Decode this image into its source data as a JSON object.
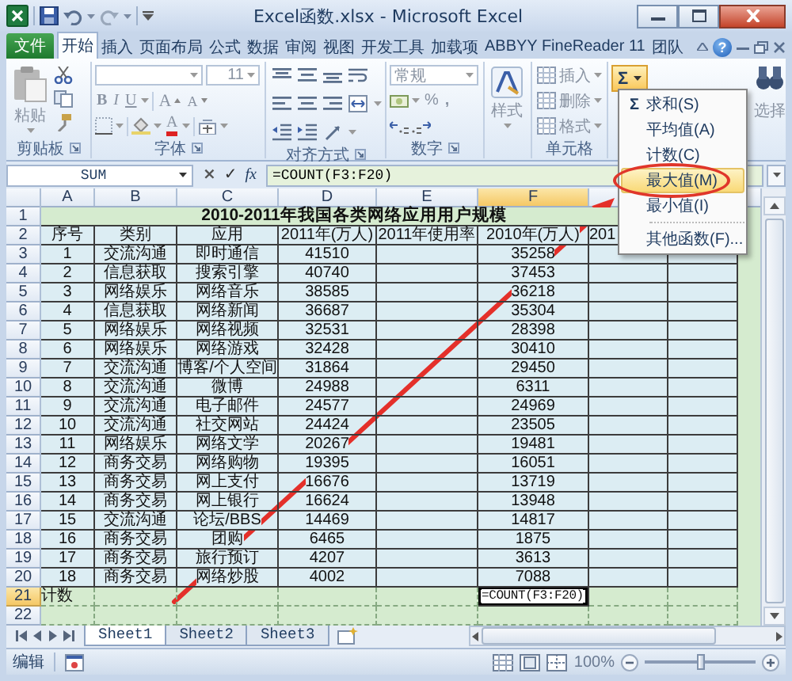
{
  "window": {
    "title": "Excel函数.xlsx - Microsoft Excel"
  },
  "ribbon_tabs": [
    {
      "label": "文件",
      "kind": "file",
      "selected": false
    },
    {
      "label": "开始",
      "kind": "tab",
      "selected": true
    },
    {
      "label": "插入",
      "kind": "tab",
      "selected": false
    },
    {
      "label": "页面布局",
      "kind": "tab",
      "selected": false
    },
    {
      "label": "公式",
      "kind": "tab",
      "selected": false
    },
    {
      "label": "数据",
      "kind": "tab",
      "selected": false
    },
    {
      "label": "审阅",
      "kind": "tab",
      "selected": false
    },
    {
      "label": "视图",
      "kind": "tab",
      "selected": false
    },
    {
      "label": "开发工具",
      "kind": "tab",
      "selected": false
    },
    {
      "label": "加载项",
      "kind": "tab",
      "selected": false
    },
    {
      "label": "ABBYY FineReader 11",
      "kind": "tab",
      "selected": false
    },
    {
      "label": "团队",
      "kind": "tab",
      "selected": false
    }
  ],
  "help": "?",
  "ribbon": {
    "disabled": true,
    "clipboard": {
      "label": "剪贴板",
      "paste": "粘贴"
    },
    "font": {
      "label": "字体",
      "size": "11",
      "bold": "B",
      "italic": "I",
      "underline": "U",
      "grow": "A",
      "shrink": "A",
      "font_color": "A"
    },
    "alignment": {
      "label": "对齐方式"
    },
    "number": {
      "label": "数字",
      "format": "常规",
      "percent": "%",
      "comma": ","
    },
    "styles": {
      "button": "样式"
    },
    "cells": {
      "label": "单元格",
      "insert": "插入",
      "delete": "删除",
      "format": "格式"
    },
    "editing": {
      "autosum": "Σ",
      "pressed": true,
      "find_select": "选择"
    }
  },
  "formula_bar": {
    "name_box": "SUM",
    "cancel": "×",
    "enter": "✓",
    "function": "fx",
    "formula": "=COUNT(F3:F20)"
  },
  "autosum_menu": {
    "items": [
      {
        "icon": "Σ",
        "label": "求和(S)",
        "kind": "function",
        "selected": false,
        "circled": false
      },
      {
        "label": "平均值(A)",
        "kind": "function",
        "selected": false,
        "circled": false
      },
      {
        "label": "计数(C)",
        "kind": "function",
        "selected": false,
        "circled": false
      },
      {
        "label": "最大值(M)",
        "kind": "function",
        "selected": true,
        "circled": true
      },
      {
        "label": "最小值(I)",
        "kind": "function",
        "selected": false,
        "circled": false
      },
      {
        "label": "其他函数(F)...",
        "kind": "more",
        "selected": false,
        "circled": false
      }
    ]
  },
  "sheet": {
    "columns": [
      {
        "label": "A",
        "selected": false
      },
      {
        "label": "B",
        "selected": false
      },
      {
        "label": "C",
        "selected": false
      },
      {
        "label": "D",
        "selected": false
      },
      {
        "label": "E",
        "selected": false
      },
      {
        "label": "F",
        "selected": true
      }
    ],
    "rows": [
      {
        "number": "1",
        "selected": false,
        "kind": "title",
        "text": "2010-2011年我国各类网络应用用户规模"
      },
      {
        "number": "2",
        "selected": false,
        "kind": "header",
        "cells": [
          "序号",
          "类别",
          "应用",
          "2011年(万人)",
          "2011年使用率",
          "2010年(万人)",
          "201"
        ]
      },
      {
        "number": "3",
        "selected": false,
        "kind": "data",
        "cells": [
          "1",
          "交流沟通",
          "即时通信",
          "41510",
          null,
          "35258"
        ]
      },
      {
        "number": "4",
        "selected": false,
        "kind": "data",
        "cells": [
          "2",
          "信息获取",
          "搜索引擎",
          "40740",
          null,
          "37453"
        ]
      },
      {
        "number": "5",
        "selected": false,
        "kind": "data",
        "cells": [
          "3",
          "网络娱乐",
          "网络音乐",
          "38585",
          null,
          "36218"
        ]
      },
      {
        "number": "6",
        "selected": false,
        "kind": "data",
        "cells": [
          "4",
          "信息获取",
          "网络新闻",
          "36687",
          null,
          "35304"
        ]
      },
      {
        "number": "7",
        "selected": false,
        "kind": "data",
        "cells": [
          "5",
          "网络娱乐",
          "网络视频",
          "32531",
          null,
          "28398"
        ]
      },
      {
        "number": "8",
        "selected": false,
        "kind": "data",
        "cells": [
          "6",
          "网络娱乐",
          "网络游戏",
          "32428",
          null,
          "30410"
        ]
      },
      {
        "number": "9",
        "selected": false,
        "kind": "data",
        "cells": [
          "7",
          "交流沟通",
          "博客/个人空间",
          "31864",
          null,
          "29450"
        ]
      },
      {
        "number": "10",
        "selected": false,
        "kind": "data",
        "cells": [
          "8",
          "交流沟通",
          "微博",
          "24988",
          null,
          "6311"
        ]
      },
      {
        "number": "11",
        "selected": false,
        "kind": "data",
        "cells": [
          "9",
          "交流沟通",
          "电子邮件",
          "24577",
          null,
          "24969"
        ]
      },
      {
        "number": "12",
        "selected": false,
        "kind": "data",
        "cells": [
          "10",
          "交流沟通",
          "社交网站",
          "24424",
          null,
          "23505"
        ]
      },
      {
        "number": "13",
        "selected": false,
        "kind": "data",
        "cells": [
          "11",
          "网络娱乐",
          "网络文学",
          "20267",
          null,
          "19481"
        ]
      },
      {
        "number": "14",
        "selected": false,
        "kind": "data",
        "cells": [
          "12",
          "商务交易",
          "网络购物",
          "19395",
          null,
          "16051"
        ]
      },
      {
        "number": "15",
        "selected": false,
        "kind": "data",
        "cells": [
          "13",
          "商务交易",
          "网上支付",
          "16676",
          null,
          "13719"
        ]
      },
      {
        "number": "16",
        "selected": false,
        "kind": "data",
        "cells": [
          "14",
          "商务交易",
          "网上银行",
          "16624",
          null,
          "13948"
        ]
      },
      {
        "number": "17",
        "selected": false,
        "kind": "data",
        "cells": [
          "15",
          "交流沟通",
          "论坛/BBS",
          "14469",
          null,
          "14817"
        ]
      },
      {
        "number": "18",
        "selected": false,
        "kind": "data",
        "cells": [
          "16",
          "商务交易",
          "团购",
          "6465",
          null,
          "1875"
        ]
      },
      {
        "number": "19",
        "selected": false,
        "kind": "data",
        "cells": [
          "17",
          "商务交易",
          "旅行预订",
          "4207",
          null,
          "3613"
        ]
      },
      {
        "number": "20",
        "selected": false,
        "kind": "data",
        "cells": [
          "18",
          "商务交易",
          "网络炒股",
          "4002",
          null,
          "7088"
        ]
      },
      {
        "number": "21",
        "selected": true,
        "kind": "total",
        "cells": [
          "计数",
          null,
          null,
          null,
          null,
          "=COUNT(F3:F20)"
        ]
      },
      {
        "number": "22",
        "selected": false,
        "kind": "total"
      }
    ]
  },
  "sheet_tabs": [
    {
      "label": "Sheet1",
      "selected": true
    },
    {
      "label": "Sheet2",
      "selected": false
    },
    {
      "label": "Sheet3",
      "selected": false
    }
  ],
  "status_bar": {
    "mode": "编辑",
    "zoom": "100%",
    "zoom_slider": {
      "level": 0.5
    }
  }
}
